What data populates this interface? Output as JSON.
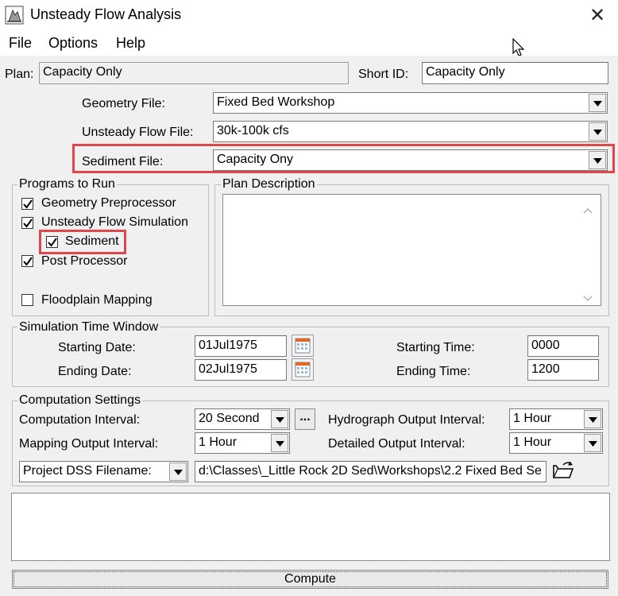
{
  "window": {
    "title": "Unsteady Flow Analysis"
  },
  "menu": {
    "file": "File",
    "options": "Options",
    "help": "Help"
  },
  "plan": {
    "plan_label": "Plan:",
    "plan_value": "Capacity Only",
    "short_id_label": "Short ID:",
    "short_id_value": "Capacity Only"
  },
  "files": {
    "geometry_label": "Geometry File:",
    "geometry_value": "Fixed Bed Workshop",
    "unsteady_label": "Unsteady Flow File:",
    "unsteady_value": "30k-100k cfs",
    "sediment_label": "Sediment File:",
    "sediment_value": "Capacity Ony"
  },
  "programs": {
    "title": "Programs to Run",
    "geometry_pre": "Geometry Preprocessor",
    "unsteady_sim": "Unsteady Flow Simulation",
    "sediment": "Sediment",
    "post_processor": "Post Processor",
    "floodplain": "Floodplain Mapping"
  },
  "plan_description": {
    "title": "Plan Description"
  },
  "sim_window": {
    "title": "Simulation Time Window",
    "start_date_label": "Starting Date:",
    "start_date": "01Jul1975",
    "end_date_label": "Ending Date:",
    "end_date": "02Jul1975",
    "start_time_label": "Starting Time:",
    "start_time": "0000",
    "end_time_label": "Ending Time:",
    "end_time": "1200"
  },
  "computation": {
    "title": "Computation Settings",
    "comp_interval_label": "Computation Interval:",
    "comp_interval": "20 Second",
    "ellipsis": "...",
    "hydro_label": "Hydrograph Output Interval:",
    "hydro_value": "1 Hour",
    "mapping_label": "Mapping Output Interval:",
    "mapping_value": "1 Hour",
    "detailed_label": "Detailed Output Interval:",
    "detailed_value": "1 Hour",
    "dss_label": "Project DSS Filename:",
    "dss_path": "d:\\Classes\\_Little Rock 2D Sed\\Workshops\\2.2 Fixed Bed Se"
  },
  "compute_button": "Compute",
  "colors": {
    "highlight": "#e0474c",
    "dialog_bg": "#f0f0f0"
  }
}
